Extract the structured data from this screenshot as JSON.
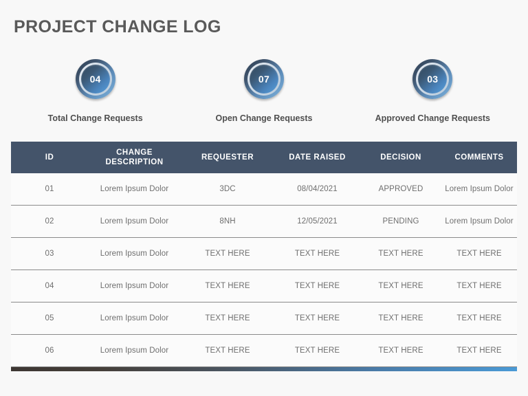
{
  "header": {
    "title": "PROJECT CHANGE LOG"
  },
  "colors": {
    "page_background": "#f8f8f8",
    "title_text": "#595959",
    "table_header_bg": "#44546a",
    "table_header_text": "#ffffff",
    "body_text": "#6e6e6e",
    "badge_blue": "#4a83bb",
    "badge_dark": "#32485e",
    "footer_gradient_start": "#3d3733",
    "footer_gradient_end": "#4a9ad6"
  },
  "kpis": [
    {
      "value": "04",
      "label": "Total Change Requests",
      "icon": "circle-badge-icon"
    },
    {
      "value": "07",
      "label": "Open Change Requests",
      "icon": "circle-badge-icon"
    },
    {
      "value": "03",
      "label": "Approved Change Requests",
      "icon": "circle-badge-icon"
    }
  ],
  "table": {
    "columns": [
      {
        "key": "id",
        "label": "ID"
      },
      {
        "key": "description",
        "label_line1": "CHANGE",
        "label_line2": "DESCRIPTION"
      },
      {
        "key": "requester",
        "label": "REQUESTER"
      },
      {
        "key": "date_raised",
        "label": "DATE RAISED"
      },
      {
        "key": "decision",
        "label": "DECISION"
      },
      {
        "key": "comments",
        "label": "COMMENTS"
      }
    ],
    "rows": [
      {
        "id": "01",
        "description": "Lorem Ipsum Dolor",
        "requester": "3DC",
        "date_raised": "08/04/2021",
        "decision": "APPROVED",
        "comments": "Lorem Ipsum Dolor"
      },
      {
        "id": "02",
        "description": "Lorem Ipsum Dolor",
        "requester": "8NH",
        "date_raised": "12/05/2021",
        "decision": "PENDING",
        "comments": "Lorem Ipsum Dolor"
      },
      {
        "id": "03",
        "description": "Lorem Ipsum Dolor",
        "requester": "TEXT HERE",
        "date_raised": "TEXT HERE",
        "decision": "TEXT HERE",
        "comments": "TEXT HERE"
      },
      {
        "id": "04",
        "description": "Lorem Ipsum Dolor",
        "requester": "TEXT HERE",
        "date_raised": "TEXT HERE",
        "decision": "TEXT HERE",
        "comments": "TEXT HERE"
      },
      {
        "id": "05",
        "description": "Lorem Ipsum Dolor",
        "requester": "TEXT HERE",
        "date_raised": "TEXT HERE",
        "decision": "TEXT HERE",
        "comments": "TEXT HERE"
      },
      {
        "id": "06",
        "description": "Lorem Ipsum Dolor",
        "requester": "TEXT HERE",
        "date_raised": "TEXT HERE",
        "decision": "TEXT HERE",
        "comments": "TEXT HERE"
      }
    ]
  }
}
